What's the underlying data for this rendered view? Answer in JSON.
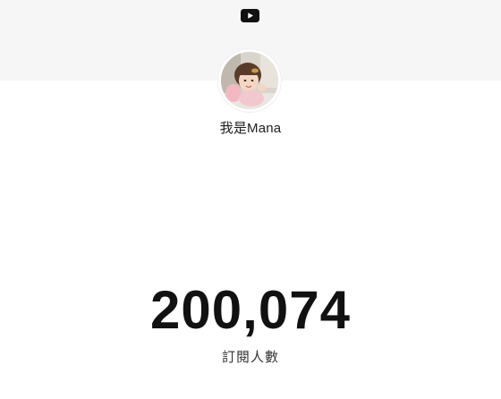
{
  "header": {
    "logo_icon": "youtube-play-icon",
    "logo_color": "#111111",
    "banner_color": "#f6f6f6"
  },
  "channel": {
    "name": "我是Mana",
    "avatar": "channel-avatar-photo"
  },
  "subscribers": {
    "count": "200,074",
    "label": "訂閱人數"
  }
}
